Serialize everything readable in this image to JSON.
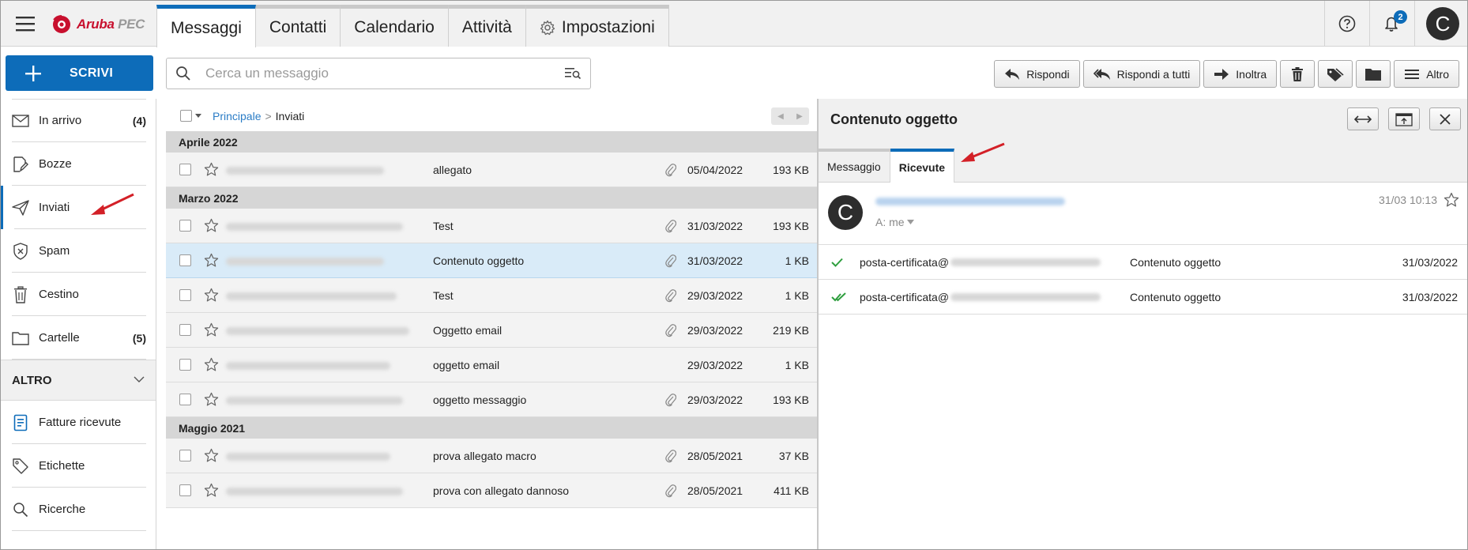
{
  "app": {
    "logo_brand": "Aruba",
    "logo_product": "PEC",
    "brand_color": "#c8102e",
    "accent_color": "#0d6cb9"
  },
  "header": {
    "tabs": [
      {
        "label": "Messaggi",
        "active": true
      },
      {
        "label": "Contatti"
      },
      {
        "label": "Calendario"
      },
      {
        "label": "Attività"
      },
      {
        "label": "Impostazioni",
        "icon": "gear-icon"
      }
    ],
    "notifications_count": "2",
    "avatar_initial": "C"
  },
  "compose": {
    "label": "SCRIVI"
  },
  "search": {
    "placeholder": "Cerca un messaggio"
  },
  "toolbar": {
    "reply": "Rispondi",
    "reply_all": "Rispondi a tutti",
    "forward": "Inoltra",
    "more": "Altro"
  },
  "sidebar": {
    "items": [
      {
        "label": "In arrivo",
        "count": "(4)",
        "icon": "inbox-icon"
      },
      {
        "label": "Bozze",
        "icon": "draft-icon"
      },
      {
        "label": "Inviati",
        "icon": "send-icon",
        "active": true
      },
      {
        "label": "Spam",
        "icon": "spam-shield-icon"
      },
      {
        "label": "Cestino",
        "icon": "trash-icon"
      },
      {
        "label": "Cartelle",
        "count": "(5)",
        "icon": "folder-icon"
      }
    ],
    "altro_label": "ALTRO",
    "extra_items": [
      {
        "label": "Fatture ricevute",
        "icon": "invoice-icon"
      },
      {
        "label": "Etichette",
        "icon": "tag-icon"
      },
      {
        "label": "Ricerche",
        "icon": "search-icon"
      }
    ]
  },
  "list": {
    "breadcrumb": {
      "root": "Principale",
      "separator": ">",
      "current": "Inviati"
    },
    "groups": [
      {
        "label": "Aprile 2022",
        "rows": [
          {
            "subject": "allegato",
            "attachment": true,
            "date": "05/04/2022",
            "size": "193 KB"
          }
        ]
      },
      {
        "label": "Marzo 2022",
        "rows": [
          {
            "subject": "Test",
            "attachment": true,
            "date": "31/03/2022",
            "size": "193 KB"
          },
          {
            "subject": "Contenuto oggetto",
            "attachment": true,
            "date": "31/03/2022",
            "size": "1 KB",
            "selected": true
          },
          {
            "subject": "Test",
            "attachment": true,
            "date": "29/03/2022",
            "size": "1 KB"
          },
          {
            "subject": "Oggetto email",
            "attachment": true,
            "date": "29/03/2022",
            "size": "219 KB"
          },
          {
            "subject": "oggetto email",
            "attachment": false,
            "date": "29/03/2022",
            "size": "1 KB"
          },
          {
            "subject": "oggetto messaggio",
            "attachment": true,
            "date": "29/03/2022",
            "size": "193 KB"
          }
        ]
      },
      {
        "label": "Maggio 2021",
        "rows": [
          {
            "subject": "prova allegato macro",
            "attachment": true,
            "date": "28/05/2021",
            "size": "37 KB"
          },
          {
            "subject": "prova con allegato dannoso",
            "attachment": true,
            "date": "28/05/2021",
            "size": "411 KB"
          }
        ]
      }
    ]
  },
  "preview": {
    "title": "Contenuto oggetto",
    "tabs": [
      {
        "label": "Messaggio"
      },
      {
        "label": "Ricevute",
        "active": true
      }
    ],
    "avatar_initial": "C",
    "to_label": "A: me",
    "date": "31/03 10:13",
    "receipts": [
      {
        "from_prefix": "posta-certificata@",
        "subject": "Contenuto oggetto",
        "date": "31/03/2022",
        "status": "accepted",
        "icon": "check-icon"
      },
      {
        "from_prefix": "posta-certificata@",
        "subject": "Contenuto oggetto",
        "date": "31/03/2022",
        "status": "delivered",
        "icon": "double-check-icon"
      }
    ]
  }
}
